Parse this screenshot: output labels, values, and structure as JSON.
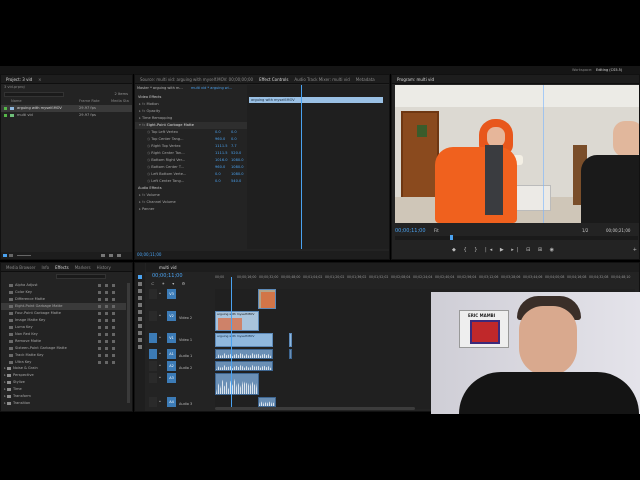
{
  "app": {
    "workspace_label": "Workspace:",
    "workspace_value": "Editing (CS5.5)"
  },
  "project": {
    "tabs": [
      "Project: 3 vid",
      "Media Browser",
      "Info",
      "Effects",
      "Markers",
      "History"
    ],
    "file": "3 vid.prproj",
    "item_count": "2 Items",
    "columns": {
      "name": "Name",
      "frame_rate": "Frame Rate",
      "media_start": "Media Sta"
    },
    "items": [
      {
        "name": "arguing with myself.MOV",
        "rate": "29.97 fps",
        "color": "#55b848"
      },
      {
        "name": "multi vid",
        "rate": "29.97 fps",
        "color": "#55b848"
      }
    ]
  },
  "effects": {
    "items": [
      "Alpha Adjust",
      "Color Key",
      "Difference Matte",
      "Eight-Point Garbage Matte",
      "Four-Point Garbage Matte",
      "Image Matte Key",
      "Luma Key",
      "Non Red Key",
      "Remove Matte",
      "Sixteen-Point Garbage Matte",
      "Track Matte Key",
      "Ultra Key"
    ],
    "folders": [
      "Noise & Grain",
      "Perspective",
      "Stylize",
      "Time",
      "Transform",
      "Transition"
    ]
  },
  "source": {
    "tabs": [
      "Source: multi vid: arguing with myself.MOV: 00;00;00;00",
      "Effect Controls",
      "Audio Track Mixer: multi vid",
      "Metadata"
    ],
    "master": "Master * arguing with m...",
    "sequence": "multi vid * arguing wi...",
    "clip_label": "arguing with myself.MOV",
    "video_effects": "Video Effects",
    "motion": "Motion",
    "opacity": "Opacity",
    "time_remapping": "Time Remapping",
    "effect_name": "Eight-Point Garbage Matte",
    "params": [
      {
        "name": "Top Left Vertex",
        "v1": "0.0",
        "v2": "0.0"
      },
      {
        "name": "Top Center Tang...",
        "v1": "960.0",
        "v2": "0.0"
      },
      {
        "name": "Right Top Vertex",
        "v1": "1111.5",
        "v2": "7.7"
      },
      {
        "name": "Right Center Tan...",
        "v1": "1111.5",
        "v2": "520.0"
      },
      {
        "name": "Bottom Right Ver...",
        "v1": "1016.0",
        "v2": "1080.0"
      },
      {
        "name": "Bottom Center T...",
        "v1": "960.0",
        "v2": "1080.0"
      },
      {
        "name": "Left Bottom Verte...",
        "v1": "0.0",
        "v2": "1080.0"
      },
      {
        "name": "Left Center Tang...",
        "v1": "0.0",
        "v2": "540.0"
      }
    ],
    "audio_effects": "Audio Effects",
    "volume": "Volume",
    "channel_volume": "Channel Volume",
    "panner": "Panner",
    "timecode": "00;00;11;00"
  },
  "program": {
    "tab": "Program: multi vid",
    "timecode": "00;00;11;00",
    "fit": "Fit",
    "ratio": "1/2",
    "duration": "00;00;21;00"
  },
  "timeline": {
    "tab": "multi vid",
    "timecode": "00;00;11;00",
    "ruler": [
      "00;00",
      "00;00;16;00",
      "00;00;32;00",
      "00;00;48;00",
      "00;01;04;02",
      "00;01;20;02",
      "00;01;36;02",
      "00;01;52;02",
      "00;02;08;04",
      "00;02;24;04",
      "00;02;40;04",
      "00;02;56;04",
      "00;03;12;06",
      "00;03;28;06",
      "00;03;44;06",
      "00;04;00;08",
      "00;04;16;08",
      "00;04;32;08",
      "00;04;48;10"
    ],
    "tracks": [
      {
        "id": "V3",
        "name": ""
      },
      {
        "id": "V2",
        "name": "Video 2"
      },
      {
        "id": "V1",
        "name": "Video 1"
      },
      {
        "id": "A1",
        "name": "Audio 1"
      },
      {
        "id": "A2",
        "name": "Audio 2"
      },
      {
        "id": "A3",
        "name": ""
      },
      {
        "id": "A4",
        "name": "Audio 3"
      }
    ],
    "clip_v1_label": "arguing with myself.MOV",
    "clip_v2_label": "arguing with myself.MOV"
  },
  "webcam": {
    "poster_text": "ERIC MAMBI"
  }
}
